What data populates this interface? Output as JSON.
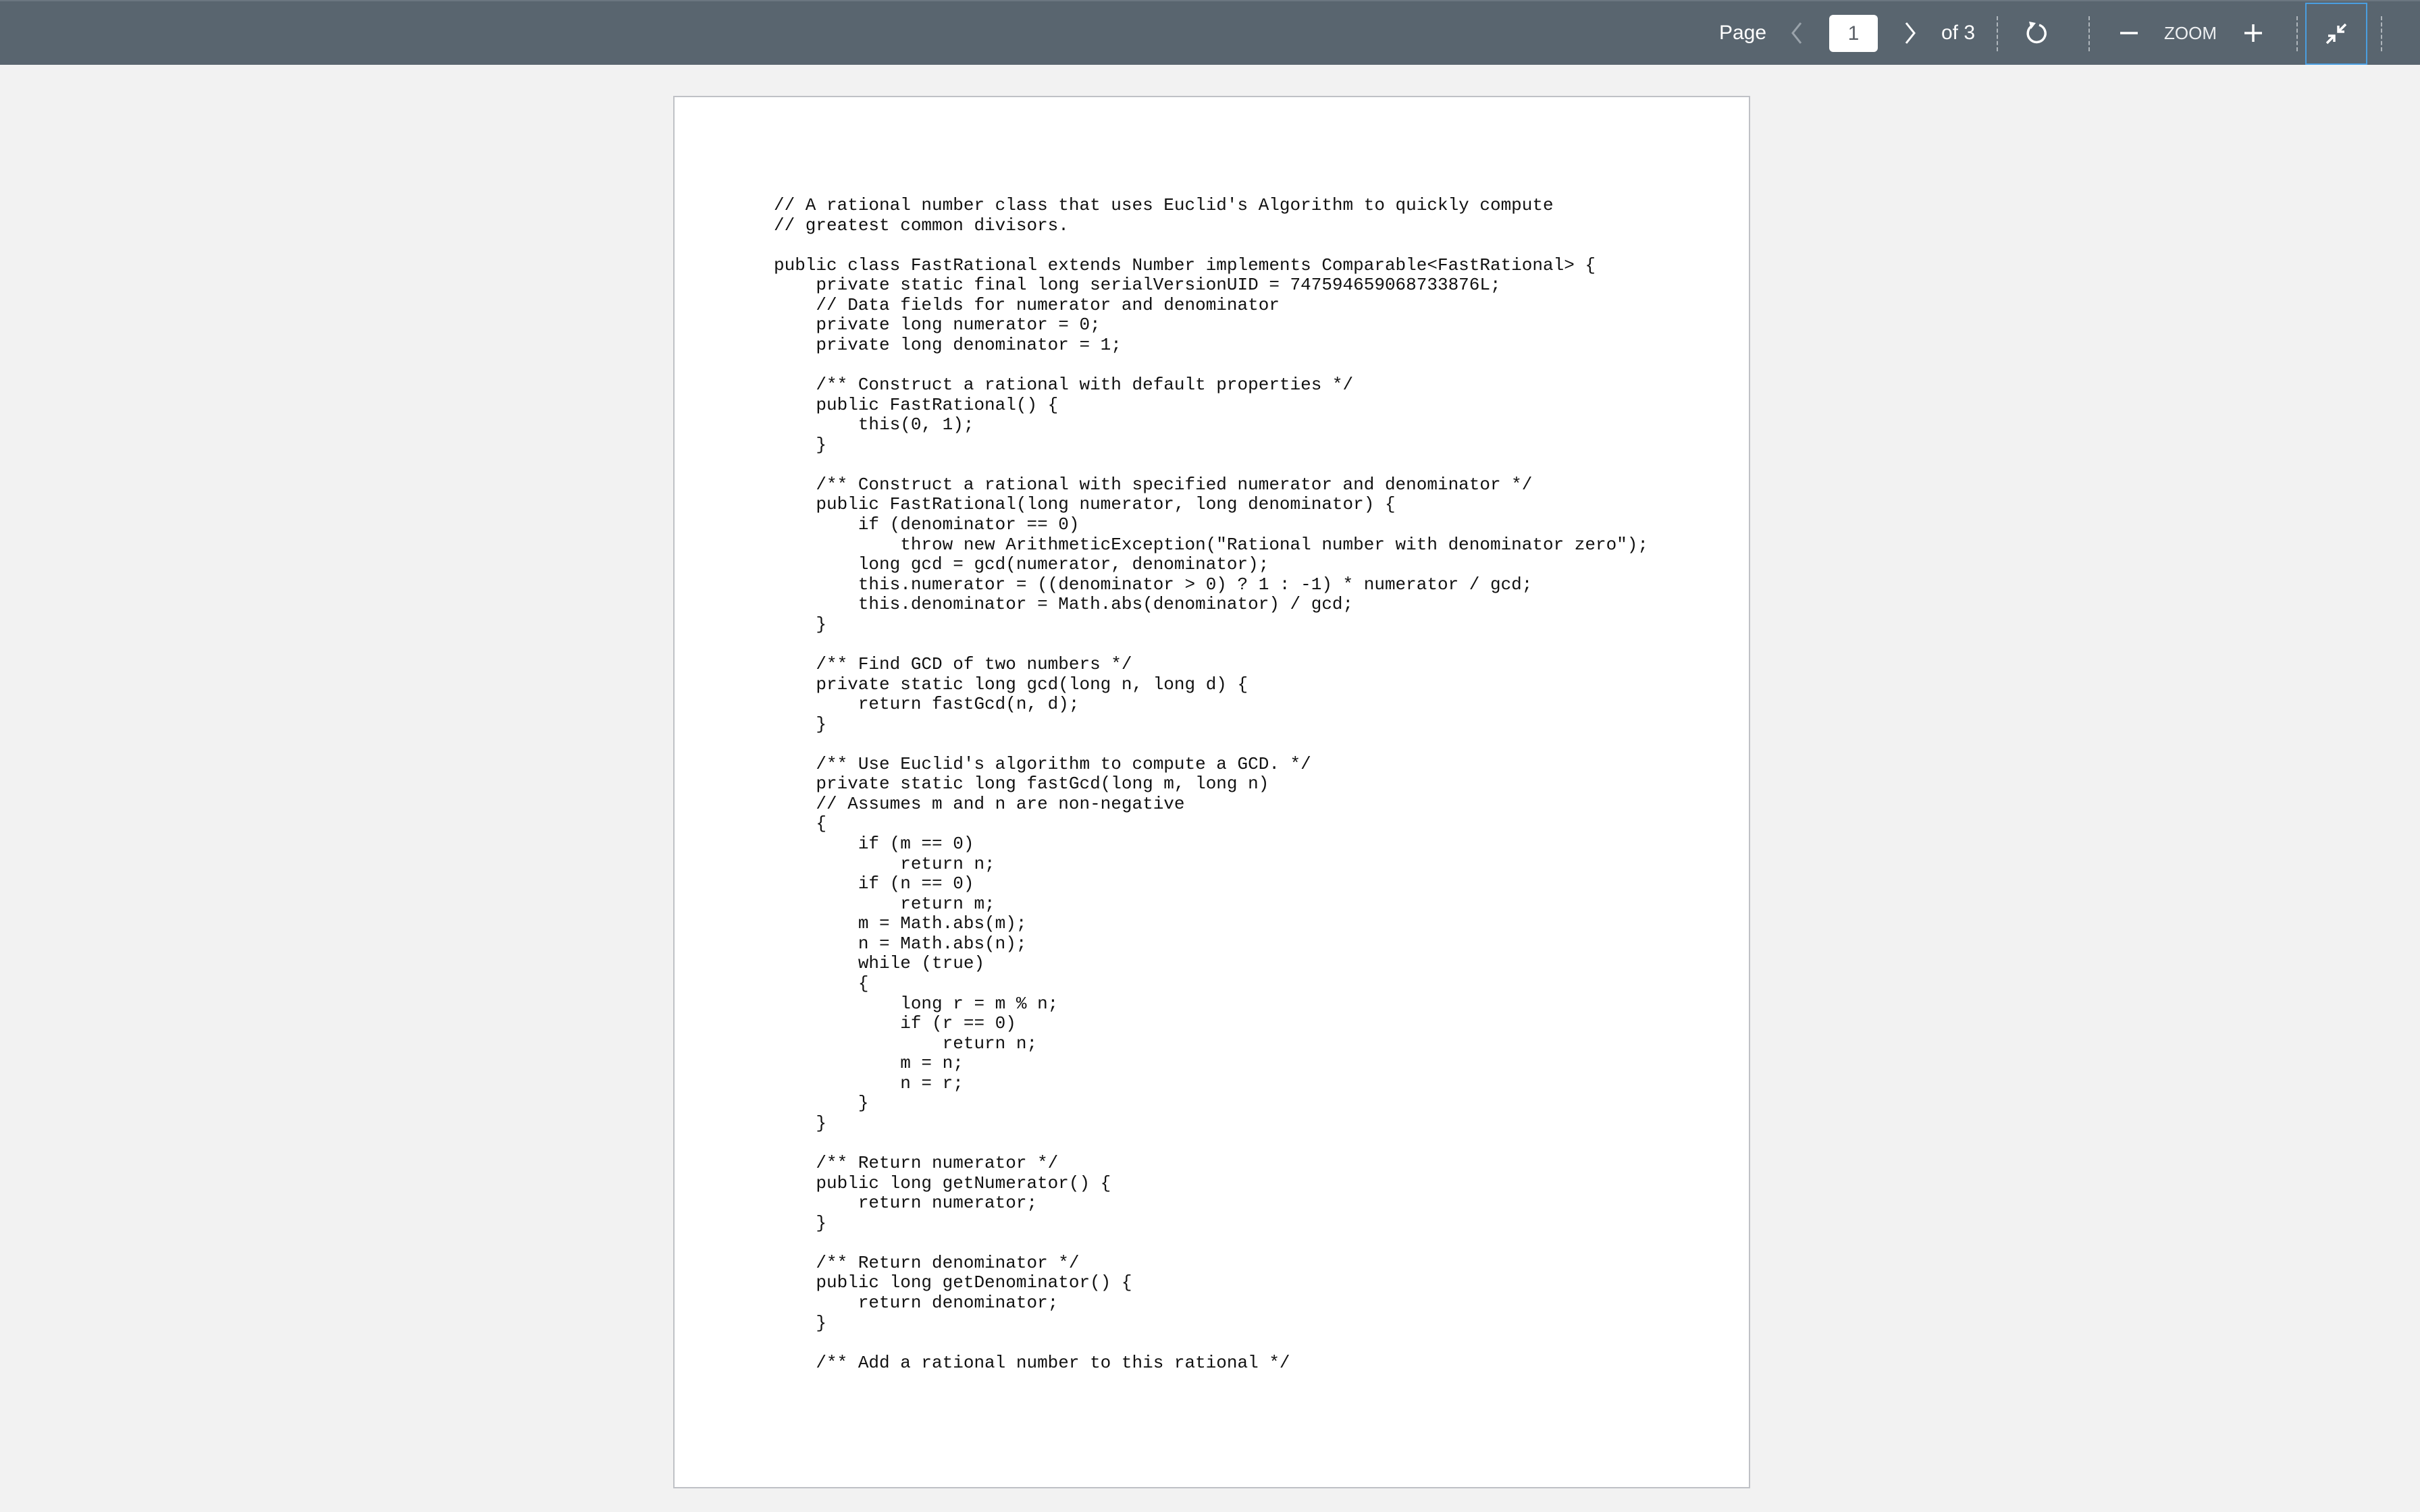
{
  "toolbar": {
    "page_label": "Page",
    "current_page": "1",
    "total_label": "of 3",
    "zoom_label": "ZOOM",
    "icons": {
      "prev": "chevron-left-icon",
      "next": "chevron-right-icon",
      "rotate": "rotate-icon",
      "zoom_out": "minus-icon",
      "zoom_in": "plus-icon",
      "collapse": "collapse-arrows-icon"
    },
    "colors": {
      "background": "#59656f",
      "active_outline": "#4a9ee0",
      "disabled_icon": "#9aa3ab"
    }
  },
  "document": {
    "lines": [
      "// A rational number class that uses Euclid's Algorithm to quickly compute",
      "// greatest common divisors.",
      "",
      "public class FastRational extends Number implements Comparable<FastRational> {",
      "    private static final long serialVersionUID = 747594659068733876L;",
      "    // Data fields for numerator and denominator",
      "    private long numerator = 0;",
      "    private long denominator = 1;",
      "",
      "    /** Construct a rational with default properties */",
      "    public FastRational() {",
      "        this(0, 1);",
      "    }",
      "",
      "    /** Construct a rational with specified numerator and denominator */",
      "    public FastRational(long numerator, long denominator) {",
      "        if (denominator == 0)",
      "            throw new ArithmeticException(\"Rational number with denominator zero\");",
      "        long gcd = gcd(numerator, denominator);",
      "        this.numerator = ((denominator > 0) ? 1 : -1) * numerator / gcd;",
      "        this.denominator = Math.abs(denominator) / gcd;",
      "    }",
      "",
      "    /** Find GCD of two numbers */",
      "    private static long gcd(long n, long d) {",
      "        return fastGcd(n, d);",
      "    }",
      "",
      "    /** Use Euclid's algorithm to compute a GCD. */",
      "    private static long fastGcd(long m, long n)",
      "    // Assumes m and n are non-negative",
      "    {",
      "        if (m == 0)",
      "            return n;",
      "        if (n == 0)",
      "            return m;",
      "        m = Math.abs(m);",
      "        n = Math.abs(n);",
      "        while (true)",
      "        {",
      "            long r = m % n;",
      "            if (r == 0)",
      "                return n;",
      "            m = n;",
      "            n = r;",
      "        }",
      "    }",
      "",
      "    /** Return numerator */",
      "    public long getNumerator() {",
      "        return numerator;",
      "    }",
      "",
      "    /** Return denominator */",
      "    public long getDenominator() {",
      "        return denominator;",
      "    }",
      "",
      "    /** Add a rational number to this rational */"
    ]
  }
}
